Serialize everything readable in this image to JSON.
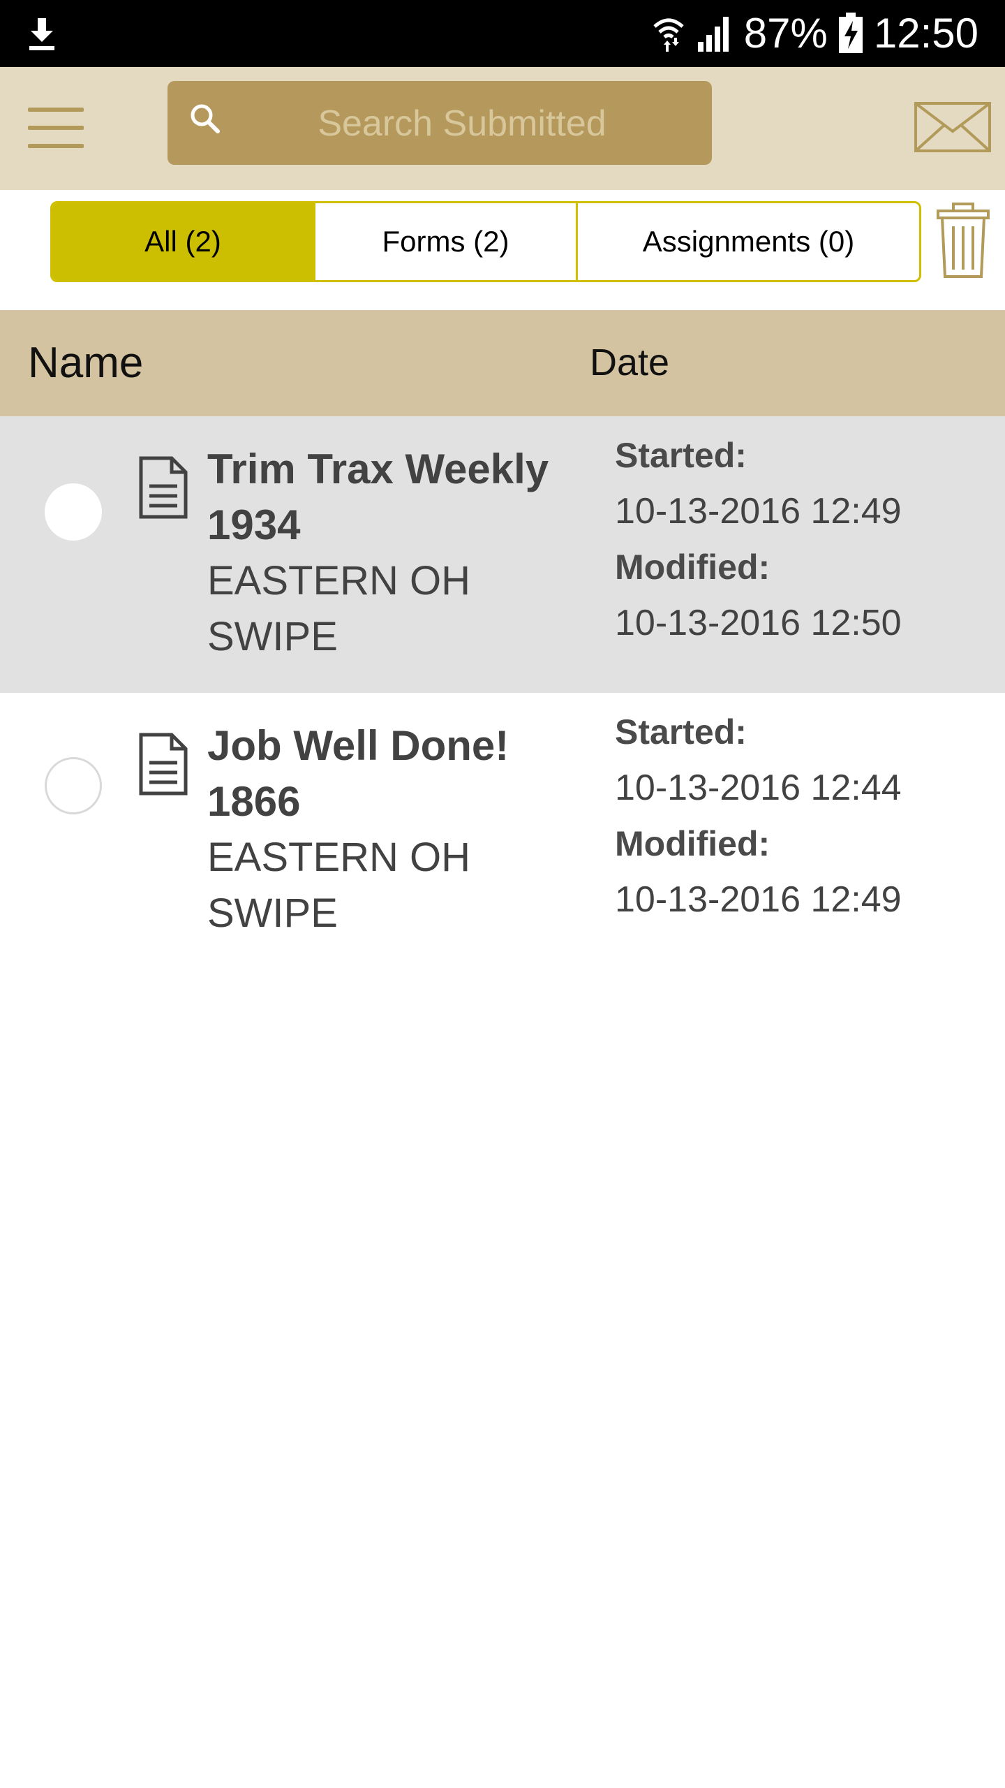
{
  "status_bar": {
    "battery": "87%",
    "time": "12:50"
  },
  "header": {
    "search_placeholder": "Search Submitted"
  },
  "filters": [
    {
      "label": "All (2)",
      "active": true
    },
    {
      "label": "Forms (2)",
      "active": false
    },
    {
      "label": "Assignments (0)",
      "active": false
    }
  ],
  "table": {
    "col_name": "Name",
    "col_date": "Date"
  },
  "rows": [
    {
      "title_line1": "Trim Trax Weekly",
      "title_line2": "1934",
      "sub_line1": "EASTERN OH",
      "sub_line2": "SWIPE",
      "started_label": "Started:",
      "started": "10-13-2016 12:49",
      "modified_label": "Modified:",
      "modified": "10-13-2016 12:50"
    },
    {
      "title_line1": "Job Well Done!",
      "title_line2": "1866",
      "sub_line1": "EASTERN OH",
      "sub_line2": "SWIPE",
      "started_label": "Started:",
      "started": "10-13-2016 12:44",
      "modified_label": "Modified:",
      "modified": "10-13-2016 12:49"
    }
  ],
  "colors": {
    "accent": "#ccbe00",
    "header_bg": "#e4d9c1",
    "search_bg": "#b5985c",
    "table_header_bg": "#d4c3a0"
  }
}
